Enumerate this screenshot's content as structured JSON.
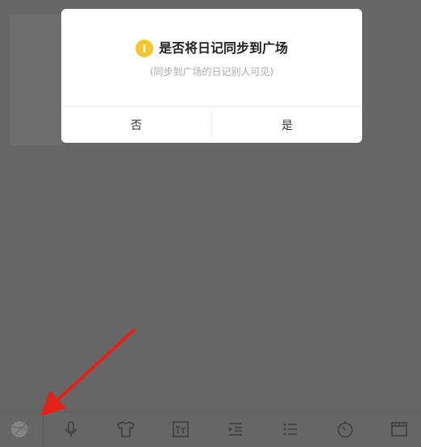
{
  "dialog": {
    "title": "是否将日记同步到广场",
    "subtitle": "(同步到广场的日记别人可见)",
    "no_label": "否",
    "yes_label": "是",
    "icon_glyph": "i"
  },
  "toolbar": {
    "buttons": [
      "ball-icon",
      "microphone-icon",
      "tshirt-icon",
      "text-size-icon",
      "indent-icon",
      "list-icon",
      "timer-icon",
      "film-icon"
    ]
  },
  "colors": {
    "overlay": "#666666",
    "dialog_bg": "#ffffff",
    "accent_yellow": "#f7c531",
    "annotation_red": "#e32119"
  }
}
